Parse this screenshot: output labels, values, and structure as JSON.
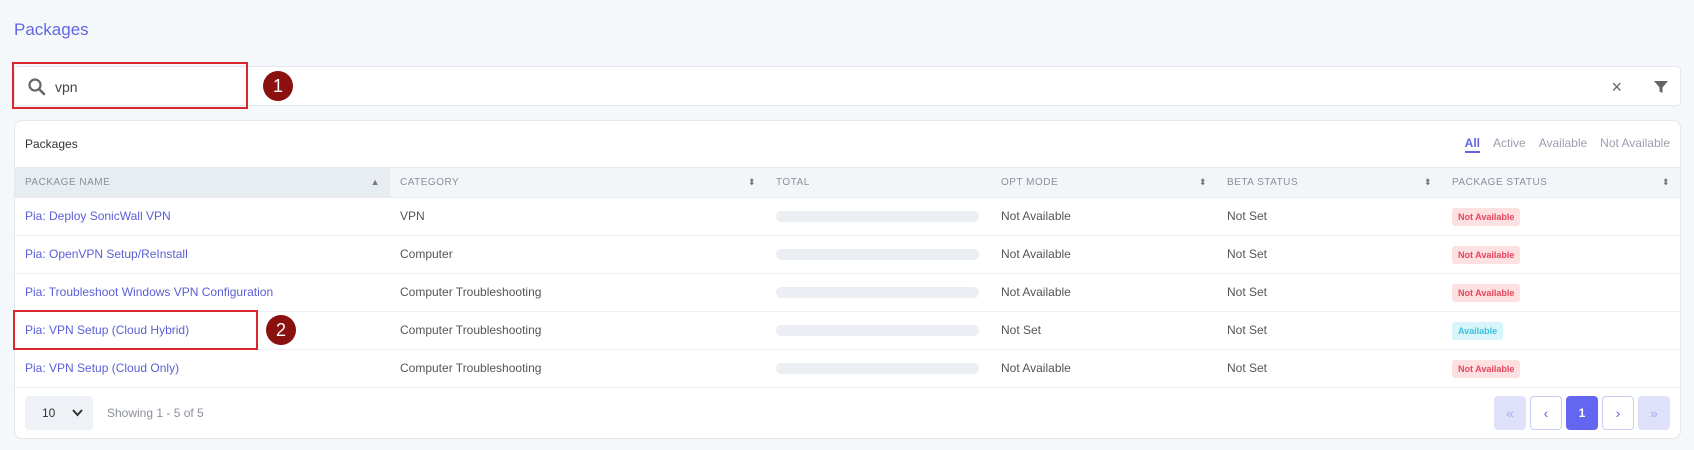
{
  "page": {
    "title": "Packages"
  },
  "search": {
    "value": "vpn",
    "clear_glyph": "×"
  },
  "annotations": [
    {
      "label": "1"
    },
    {
      "label": "2"
    }
  ],
  "colors": {
    "accent": "#6366e0",
    "annotation_red": "#d9272e",
    "badge_bg": "#8b1010"
  },
  "card": {
    "title": "Packages",
    "tabs": [
      {
        "label": "All",
        "active": true
      },
      {
        "label": "Active",
        "active": false
      },
      {
        "label": "Available",
        "active": false
      },
      {
        "label": "Not Available",
        "active": false
      }
    ]
  },
  "table": {
    "columns": [
      "PACKAGE NAME",
      "CATEGORY",
      "TOTAL",
      "OPT MODE",
      "BETA STATUS",
      "PACKAGE STATUS"
    ],
    "sort_glyphs": {
      "asc": "▲",
      "both": "⬍"
    },
    "rows": [
      {
        "name": "Pia: Deploy SonicWall VPN",
        "category": "VPN",
        "opt_mode": "Not Available",
        "beta_status": "Not Set",
        "package_status": "Not Available"
      },
      {
        "name": "Pia: OpenVPN Setup/ReInstall",
        "category": "Computer",
        "opt_mode": "Not Available",
        "beta_status": "Not Set",
        "package_status": "Not Available"
      },
      {
        "name": "Pia: Troubleshoot Windows VPN Configuration",
        "category": "Computer Troubleshooting",
        "opt_mode": "Not Available",
        "beta_status": "Not Set",
        "package_status": "Not Available"
      },
      {
        "name": "Pia: VPN Setup (Cloud Hybrid)",
        "category": "Computer Troubleshooting",
        "opt_mode": "Not Set",
        "beta_status": "Not Set",
        "package_status": "Available"
      },
      {
        "name": "Pia: VPN Setup (Cloud Only)",
        "category": "Computer Troubleshooting",
        "opt_mode": "Not Available",
        "beta_status": "Not Set",
        "package_status": "Not Available"
      }
    ]
  },
  "footer": {
    "page_size": "10",
    "showing": "Showing 1 - 5 of 5",
    "pager": {
      "first": "«",
      "prev": "‹",
      "current": "1",
      "next": "›",
      "last": "»"
    }
  },
  "icons": {
    "search": "search-icon",
    "filter": "filter-icon",
    "clear": "close-icon",
    "dropdown": "chevron-down-icon"
  }
}
